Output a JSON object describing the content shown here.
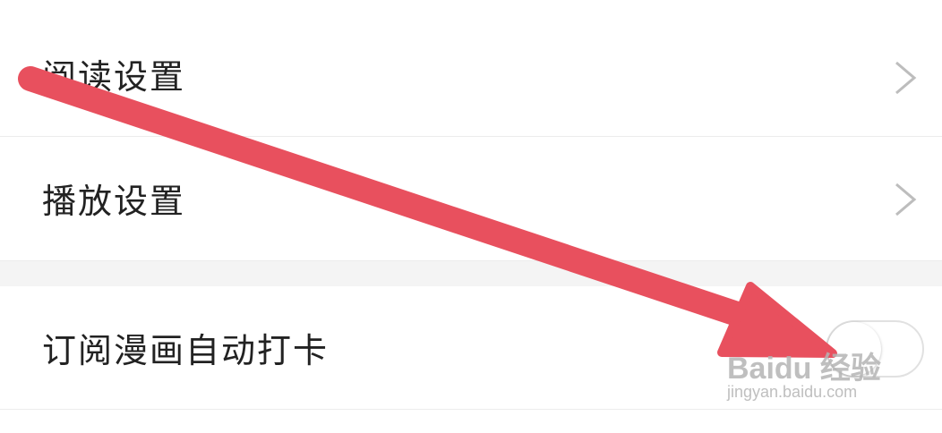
{
  "settings": {
    "items": [
      {
        "label": "阅读设置",
        "type": "link",
        "icon": "chevron-right-icon"
      },
      {
        "label": "播放设置",
        "type": "link",
        "icon": "chevron-right-icon"
      },
      {
        "label": "订阅漫画自动打卡",
        "type": "toggle",
        "toggle_state": "off"
      }
    ]
  },
  "annotation": {
    "arrow_color": "#e8505e"
  },
  "watermark": {
    "brand": "Baidu 经验",
    "url": "jingyan.baidu.com"
  }
}
